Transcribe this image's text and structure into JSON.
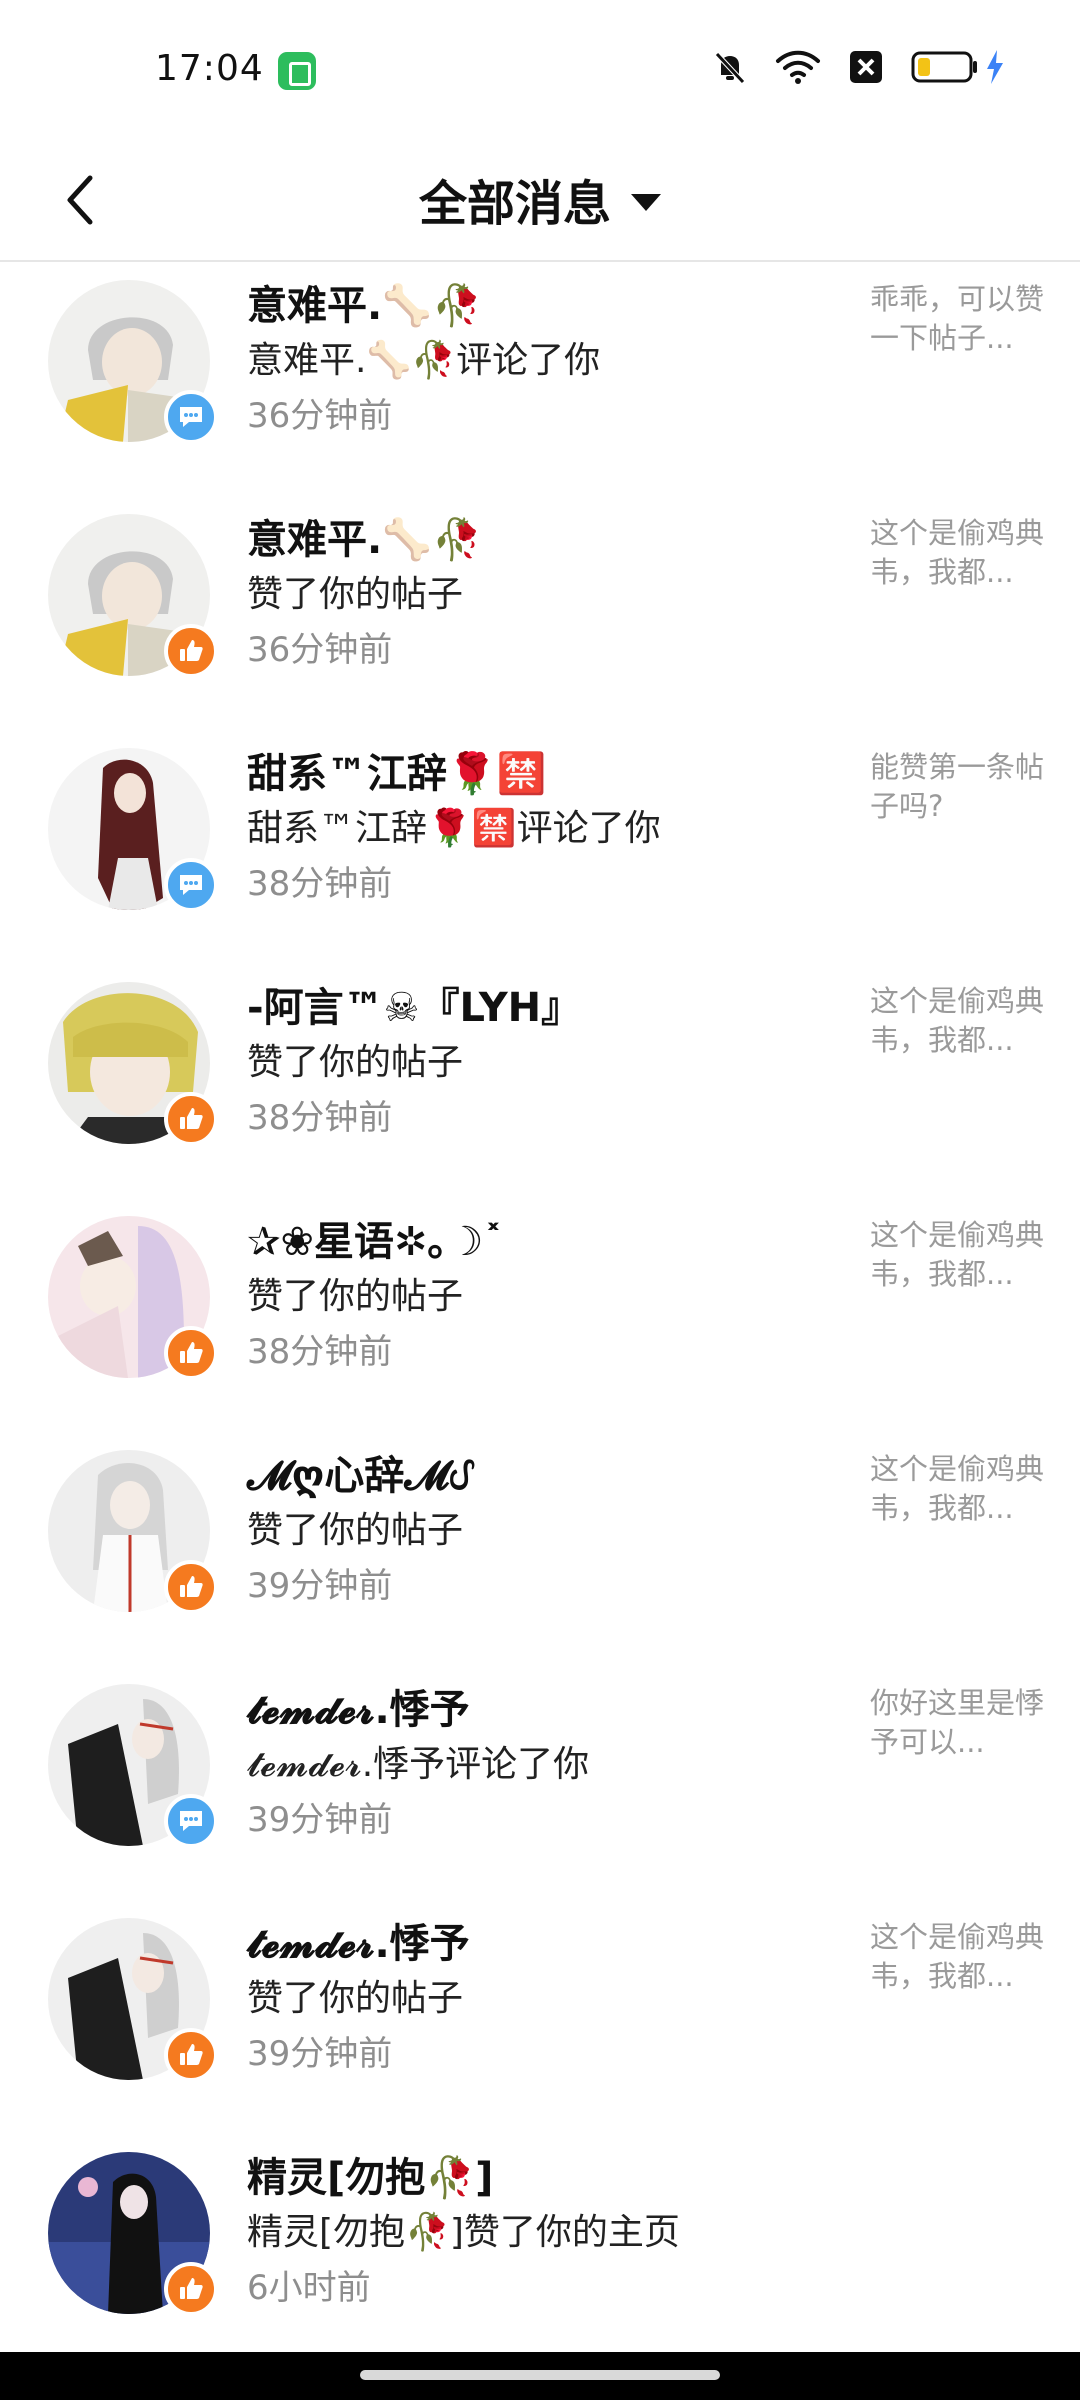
{
  "status_bar": {
    "time": "17:04",
    "icons": [
      "app-icon",
      "mute-icon",
      "wifi-icon",
      "sim-off-icon",
      "battery-icon",
      "charging-icon"
    ],
    "battery_fraction": 0.2
  },
  "header": {
    "title": "全部消息",
    "back_icon": "chevron-left-icon",
    "dropdown_icon": "triangle-down-icon"
  },
  "colors": {
    "comment_badge": "#4ea8f0",
    "like_badge": "#f57a1f",
    "time_text": "#8e8e8e",
    "preview_text": "#9a9a9a"
  },
  "messages": [
    {
      "name": "意难平.🦴🥀",
      "action": "意难平.🦴🥀评论了你",
      "time": "36分钟前",
      "preview": "乖乖，可以赞一下帖子...",
      "type": "comment"
    },
    {
      "name": "意难平.🦴🥀",
      "action": "赞了你的帖子",
      "time": "36分钟前",
      "preview": "这个是偷鸡典韦，我都...",
      "type": "like"
    },
    {
      "name": "甜系™江辞🌹🈲",
      "action": "甜系™江辞🌹🈲评论了你",
      "time": "38分钟前",
      "preview": "能赞第一条帖子吗?",
      "type": "comment"
    },
    {
      "name": "-阿言™☠『LYH』",
      "action": "赞了你的帖子",
      "time": "38分钟前",
      "preview": "这个是偷鸡典韦，我都...",
      "type": "like"
    },
    {
      "name": "✰❀星语✲｡☽˟",
      "action": "赞了你的帖子",
      "time": "38分钟前",
      "preview": "这个是偷鸡典韦，我都...",
      "type": "like"
    },
    {
      "name": "𝓜ღ心辞𝓜ᦔ",
      "action": "赞了你的帖子",
      "time": "39分钟前",
      "preview": "这个是偷鸡典韦，我都...",
      "type": "like"
    },
    {
      "name": "𝓽𝓮𝓶𝓭𝓮𝓻.悸予",
      "action": "𝓽𝓮𝓶𝓭𝓮𝓻.悸予评论了你",
      "time": "39分钟前",
      "preview": "你好这里是悸予可以...",
      "type": "comment"
    },
    {
      "name": "𝓽𝓮𝓶𝓭𝓮𝓻.悸予",
      "action": "赞了你的帖子",
      "time": "39分钟前",
      "preview": "这个是偷鸡典韦，我都...",
      "type": "like"
    },
    {
      "name": "精灵[勿抱🥀]",
      "action": "精灵[勿抱🥀]赞了你的主页",
      "time": "6小时前",
      "preview": "",
      "type": "like"
    }
  ]
}
